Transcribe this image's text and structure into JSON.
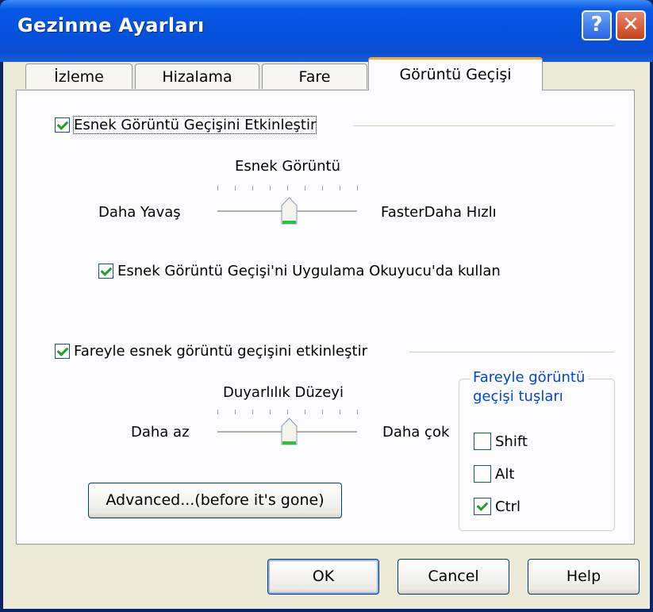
{
  "window": {
    "title": "Gezinme Ayarları"
  },
  "tabs": [
    {
      "label": "İzleme",
      "active": false
    },
    {
      "label": "Hizalama",
      "active": false
    },
    {
      "label": "Fare",
      "active": false
    },
    {
      "label": "Görüntü Geçişi",
      "active": true
    }
  ],
  "smooth_scroll": {
    "enable_label": "Esnek Görüntü Geçişini Etkinleştir",
    "enable_checked": true,
    "slider_title": "Esnek Görüntü",
    "slider_min_label": "Daha Yavaş",
    "slider_max_label": "FasterDaha Hızlı",
    "slider_value": 0.5,
    "reader_label": "Esnek Görüntü Geçişi'ni Uygulama Okuyucu'da kullan",
    "reader_checked": true
  },
  "mouse_scroll": {
    "enable_label": "Fareyle esnek görüntü geçişini etkinleştir",
    "enable_checked": true,
    "slider_title": "Duyarlılık Düzeyi",
    "slider_min_label": "Daha az",
    "slider_max_label": "Daha çok",
    "slider_value": 0.5,
    "keys_group_title_line1": "Fareyle görüntü",
    "keys_group_title_line2": "geçişi tuşları",
    "keys": [
      {
        "label": "Shift",
        "checked": false
      },
      {
        "label": "Alt",
        "checked": false
      },
      {
        "label": "Ctrl",
        "checked": true
      }
    ],
    "advanced_button": "Advanced...(before it's gone)"
  },
  "buttons": {
    "ok": "OK",
    "cancel": "Cancel",
    "help": "Help"
  },
  "colors": {
    "titlebar": "#0550dc",
    "accent_tab": "#f7a838",
    "check": "#21a121",
    "group_title": "#0046d5"
  }
}
